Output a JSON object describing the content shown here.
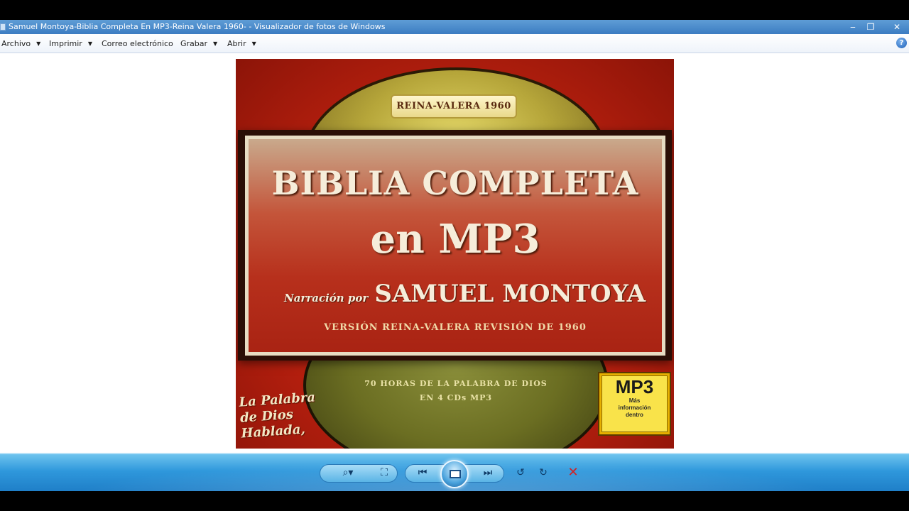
{
  "window": {
    "title": "Samuel Montoya-Biblia Completa En MP3-Reina Valera 1960- - Visualizador de fotos de Windows",
    "minimize": "‒",
    "restore": "❐",
    "close": "✕"
  },
  "menu": {
    "items": [
      {
        "label": "Archivo",
        "has_dropdown": true
      },
      {
        "label": "Imprimir",
        "has_dropdown": true
      },
      {
        "label": "Correo electrónico",
        "has_dropdown": false
      },
      {
        "label": "Grabar",
        "has_dropdown": true
      },
      {
        "label": "Abrir",
        "has_dropdown": true
      }
    ],
    "help": "?"
  },
  "image": {
    "badge_top": "REINA-VALERA 1960",
    "title_line1": "BIBLIA COMPLETA",
    "title_line2": "en MP3",
    "narration_prefix": "Narración por",
    "narrator": "SAMUEL MONTOYA",
    "version": "VERSIÓN REINA-VALERA REVISIÓN DE 1960",
    "disc_line1": "70 HORAS DE LA PALABRA DE DIOS",
    "disc_line2": "EN 4 CDs MP3",
    "slogan_line1": "La Palabra",
    "slogan_line2": "de Dios",
    "slogan_line3": "Hablada,",
    "mp3_badge_big": "MP3",
    "mp3_badge_small1": "Más",
    "mp3_badge_small2": "información",
    "mp3_badge_small3": "dentro"
  },
  "controls": {
    "zoom_icon": "⌕▾",
    "fit_icon": "⛶",
    "prev_icon": "⏮",
    "next_icon": "⏭",
    "rotate_ccw_icon": "↺",
    "rotate_cw_icon": "↻",
    "delete_icon": "✕"
  },
  "colors": {
    "titlebar": "#3b7cc2",
    "controlbar": "#2f98dc",
    "cover_red": "#b8200f"
  }
}
